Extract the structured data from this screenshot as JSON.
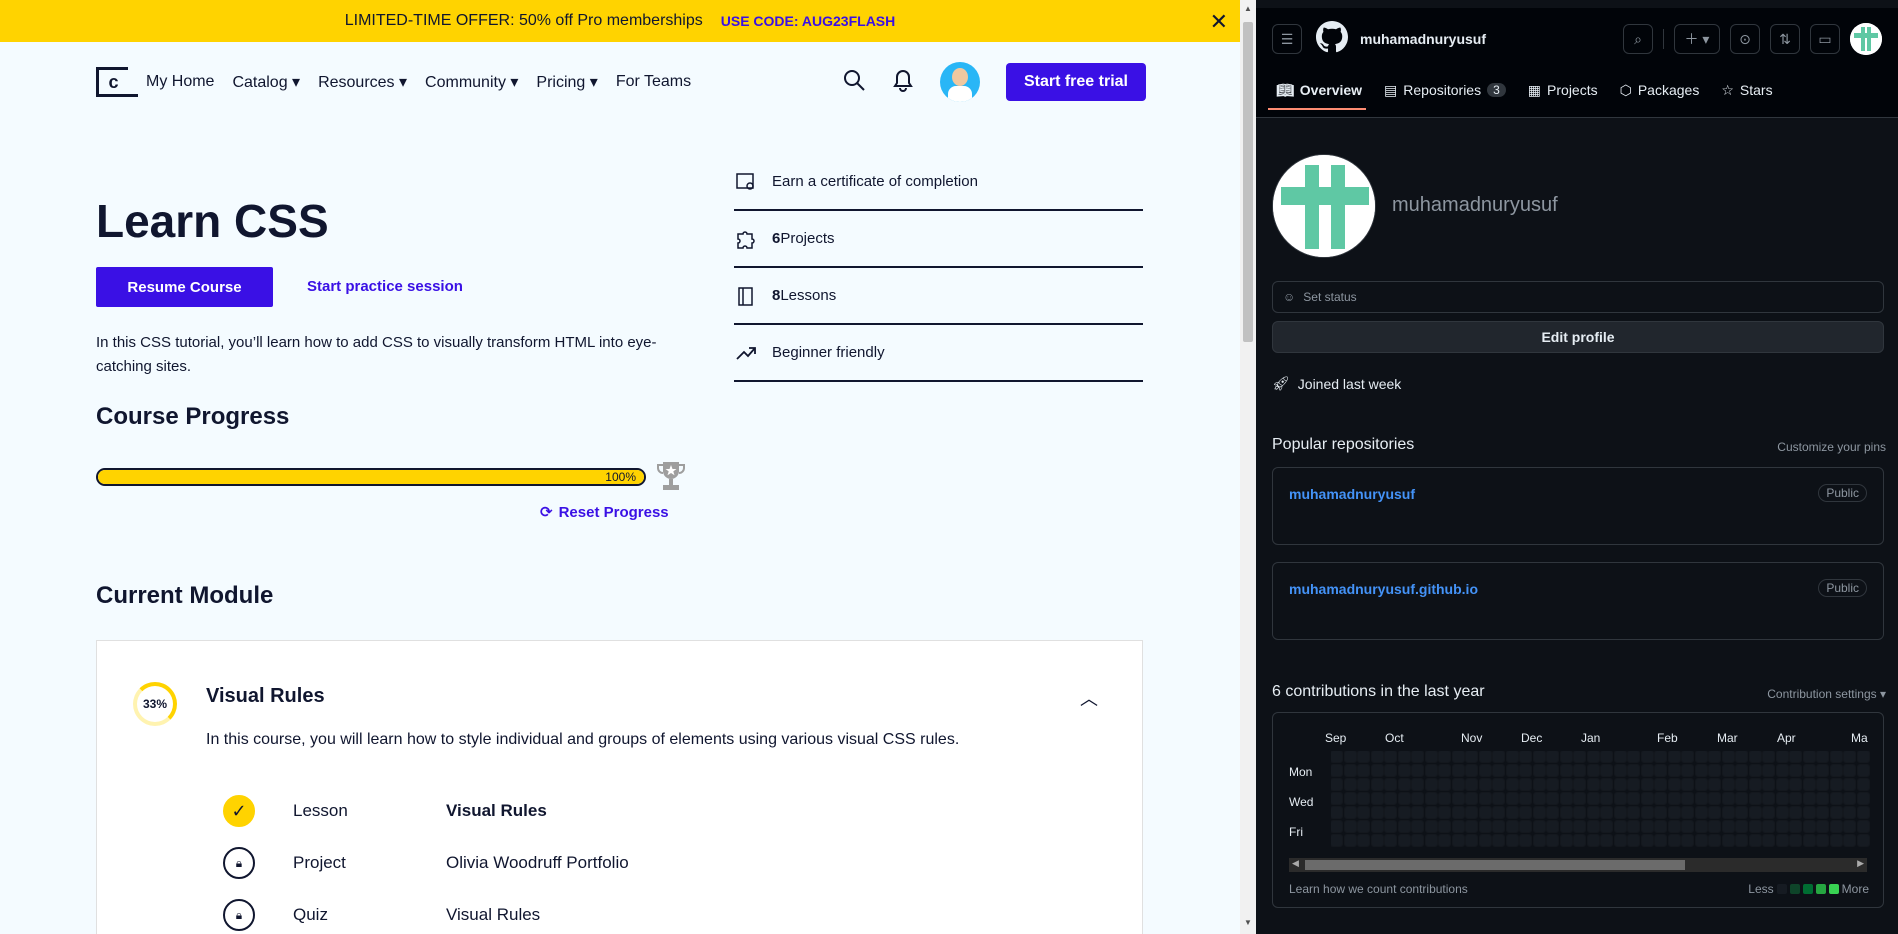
{
  "promo": {
    "text": "LIMITED-TIME OFFER: 50% off Pro memberships",
    "code": "USE CODE: AUG23FLASH"
  },
  "nav": {
    "logo": "c",
    "items": [
      "My Home",
      "Catalog ▾",
      "Resources ▾",
      "Community ▾",
      "Pricing ▾",
      "For Teams"
    ],
    "cta": "Start free trial"
  },
  "course": {
    "title": "Learn CSS",
    "resume": "Resume Course",
    "practice": "Start practice session",
    "description": "In this CSS tutorial, you’ll learn how to add CSS to visually transform HTML into eye-catching sites.",
    "features": [
      {
        "icon": "certificate-icon",
        "text": "Earn a certificate of completion"
      },
      {
        "icon": "puzzle-icon",
        "num": "6",
        "text": " Projects"
      },
      {
        "icon": "book-icon",
        "num": "8",
        "text": " Lessons"
      },
      {
        "icon": "trending-up-icon",
        "text": "Beginner friendly"
      }
    ]
  },
  "progress": {
    "heading": "Course Progress",
    "percent": 100,
    "label": "100%",
    "reset": "Reset Progress"
  },
  "module": {
    "heading": "Current Module",
    "percent_label": "33%",
    "percent": 33,
    "title": "Visual Rules",
    "description": "In this course, you will learn how to style individual and groups of elements using various visual CSS rules.",
    "items": [
      {
        "type": "Lesson",
        "name": "Visual Rules",
        "done": true
      },
      {
        "type": "Project",
        "name": "Olivia Woodruff Portfolio",
        "done": false
      },
      {
        "type": "Quiz",
        "name": "Visual Rules",
        "done": false
      }
    ]
  },
  "github": {
    "username": "muhamadnuryusuf",
    "tabs": [
      {
        "label": "Overview",
        "icon": "book-icon"
      },
      {
        "label": "Repositories",
        "icon": "repo-icon",
        "count": "3"
      },
      {
        "label": "Projects",
        "icon": "table-icon"
      },
      {
        "label": "Packages",
        "icon": "package-icon"
      },
      {
        "label": "Stars",
        "icon": "star-icon"
      }
    ],
    "login": "muhamadnuryusuf",
    "set_status": "Set status",
    "edit_profile": "Edit profile",
    "joined": "Joined last week",
    "popular_heading": "Popular repositories",
    "customize": "Customize your pins",
    "repos": [
      {
        "name": "muhamadnuryusuf",
        "visibility": "Public"
      },
      {
        "name": "muhamadnuryusuf.github.io",
        "visibility": "Public"
      }
    ],
    "contrib_heading": "6 contributions in the last year",
    "contrib_settings": "Contribution settings ▾",
    "months": [
      "Sep",
      "Oct",
      "Nov",
      "Dec",
      "Jan",
      "Feb",
      "Mar",
      "Apr",
      "Ma"
    ],
    "days": [
      "Mon",
      "Wed",
      "Fri"
    ],
    "learn": "Learn how we count contributions",
    "less": "Less",
    "more": "More",
    "legend_colors": [
      "#161b22",
      "#0e4429",
      "#006d32",
      "#26a641",
      "#39d353"
    ]
  }
}
